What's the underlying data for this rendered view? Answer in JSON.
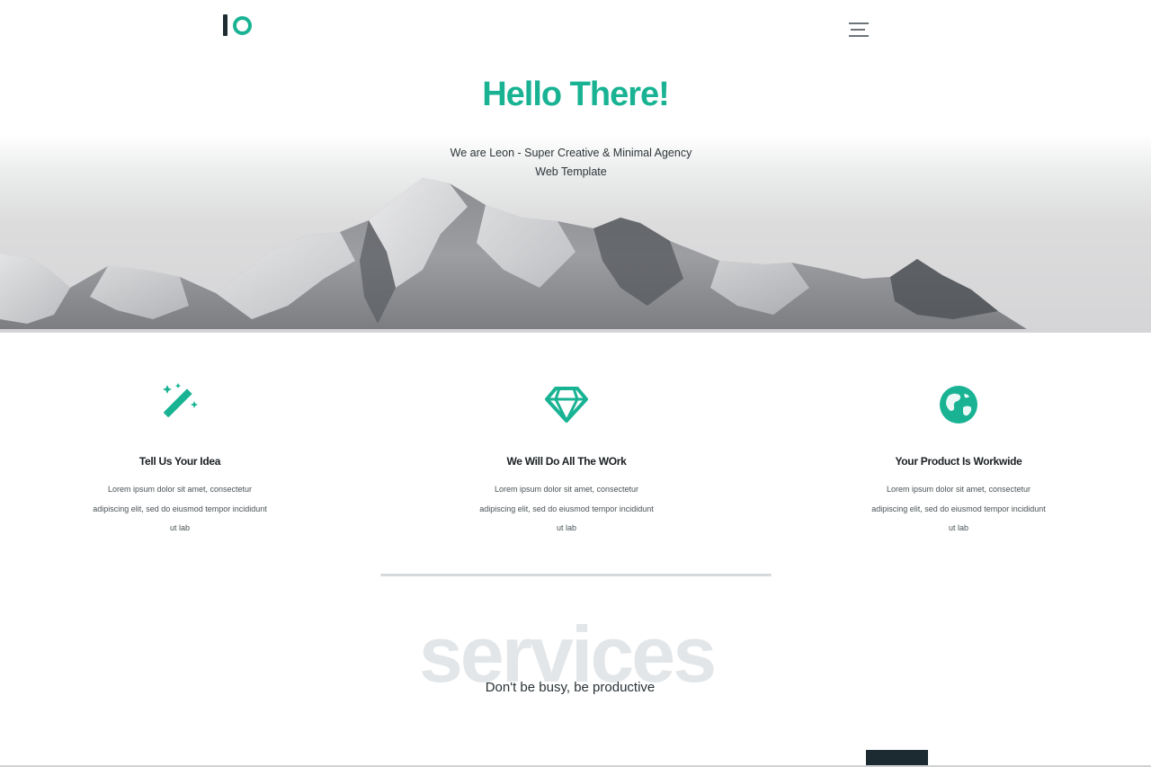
{
  "header": {
    "logo_text": "IO",
    "menu_icon": "hamburger-menu-icon"
  },
  "hero": {
    "title": "Hello There!",
    "subtitle": "We are Leon - Super Creative & Minimal Agency  Web Template",
    "background": "snowy-mountain-range-photo"
  },
  "features": [
    {
      "icon": "magic-wand-icon",
      "title": "Tell Us Your Idea",
      "text": "Lorem ipsum dolor sit amet, consectetur adipiscing elit, sed do eiusmod tempor incididunt ut lab"
    },
    {
      "icon": "diamond-icon",
      "title": "We Will Do All The WOrk",
      "text": "Lorem ipsum dolor sit amet, consectetur adipiscing elit, sed do eiusmod tempor incididunt ut lab"
    },
    {
      "icon": "globe-icon",
      "title": "Your Product Is Workwide",
      "text": "Lorem ipsum dolor sit amet, consectetur adipiscing elit, sed do eiusmod tempor incididunt ut lab"
    }
  ],
  "services": {
    "heading": "services",
    "tagline": "Don't be busy, be productive"
  },
  "colors": {
    "accent": "#19b394",
    "dark": "#1c2a31",
    "services_watermark": "#e3e6e9"
  }
}
